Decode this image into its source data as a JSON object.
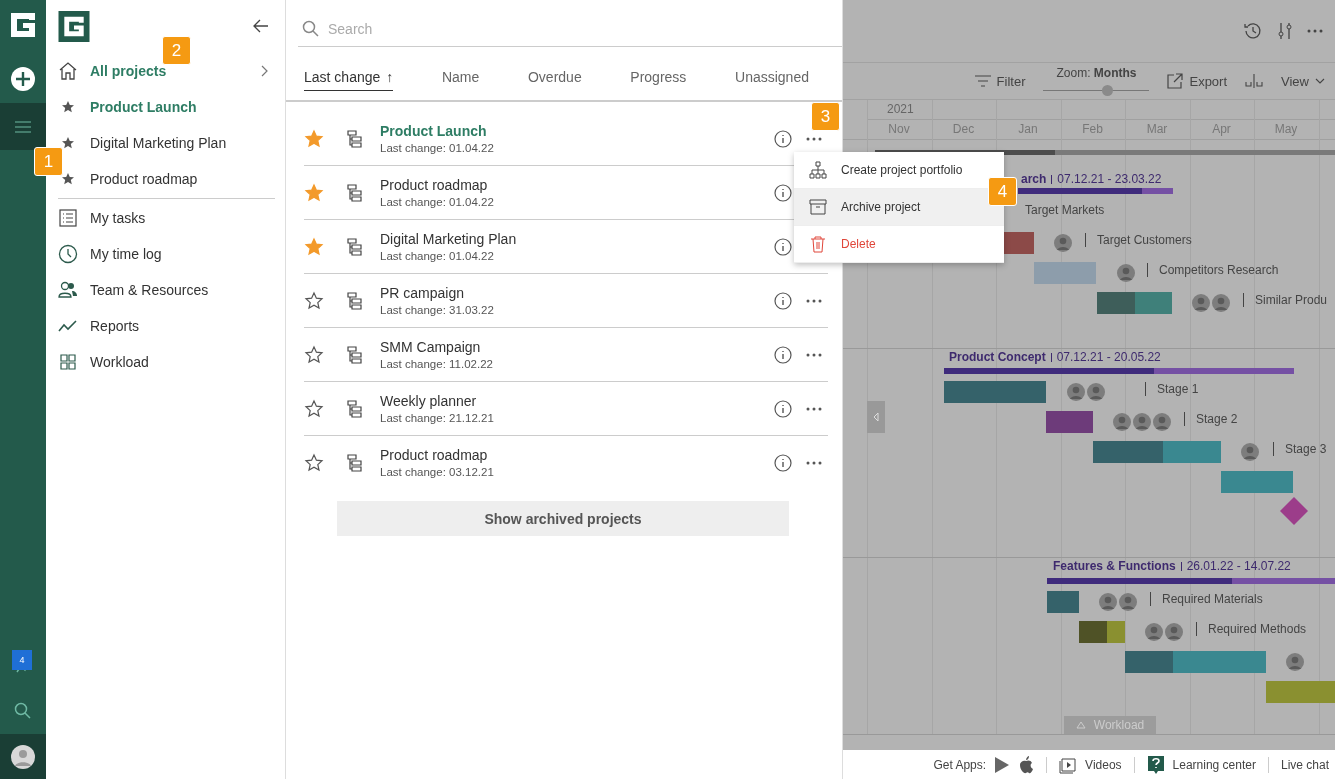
{
  "rail": {
    "notification_count": "4"
  },
  "sidebar": {
    "top": {
      "label": "All projects",
      "selected": true
    },
    "favorites": [
      {
        "label": "Product Launch",
        "selected": true
      },
      {
        "label": "Digital Marketing Plan",
        "selected": false
      },
      {
        "label": "Product roadmap",
        "selected": false
      }
    ],
    "menu": [
      {
        "label": "My tasks",
        "kind": "tasks"
      },
      {
        "label": "My time log",
        "kind": "timelog"
      },
      {
        "label": "Team & Resources",
        "kind": "team"
      },
      {
        "label": "Reports",
        "kind": "reports"
      },
      {
        "label": "Workload",
        "kind": "workload"
      }
    ]
  },
  "projects_panel": {
    "search": {
      "placeholder": "Search"
    },
    "sort_tabs": [
      {
        "label": "Last change",
        "selected": true,
        "arrow": "↑"
      },
      {
        "label": "Name",
        "selected": false
      },
      {
        "label": "Overdue",
        "selected": false
      },
      {
        "label": "Progress",
        "selected": false
      },
      {
        "label": "Unassigned",
        "selected": false
      }
    ],
    "projects": [
      {
        "name": "Product Launch",
        "last_change": "Last change: 01.04.22",
        "starred": true,
        "selected": true
      },
      {
        "name": "Product roadmap",
        "last_change": "Last change: 01.04.22",
        "starred": true,
        "selected": false
      },
      {
        "name": "Digital Marketing Plan",
        "last_change": "Last change: 01.04.22",
        "starred": true,
        "selected": false
      },
      {
        "name": "PR campaign",
        "last_change": "Last change: 31.03.22",
        "starred": false,
        "selected": false
      },
      {
        "name": "SMM Campaign",
        "last_change": "Last change: 11.02.22",
        "starred": false,
        "selected": false
      },
      {
        "name": "Weekly planner",
        "last_change": "Last change: 21.12.21",
        "starred": false,
        "selected": false
      },
      {
        "name": "Product roadmap",
        "last_change": "Last change: 03.12.21",
        "starred": false,
        "selected": false
      }
    ],
    "archived_button": "Show archived projects"
  },
  "context_menu": {
    "items": [
      {
        "label": "Create project portfolio",
        "kind": "portfolio",
        "selected": false
      },
      {
        "label": "Archive project",
        "kind": "archive",
        "selected": true
      },
      {
        "label": "Delete",
        "kind": "delete",
        "selected": false
      }
    ]
  },
  "gantt": {
    "toolbar": {
      "filter": "Filter",
      "zoom": {
        "label": "Zoom:",
        "value": "Months",
        "level": 0.6
      },
      "export": "Export",
      "view": "View"
    },
    "year": "2021",
    "months": [
      "Nov",
      "Dec",
      "Jan",
      "Feb",
      "Mar",
      "Apr",
      "May"
    ],
    "groups": [
      {
        "title": "arch",
        "dates": "07.12.21 - 23.03.22",
        "level": 0.8,
        "tasks": [
          {
            "label": "Target Markets"
          },
          {
            "label": "Target Customers"
          },
          {
            "label": "Competitors Research"
          },
          {
            "label": "Similar Produ"
          }
        ]
      },
      {
        "title": "Product Concept",
        "dates": "07.12.21 - 20.05.22",
        "level": 0.6,
        "tasks": [
          {
            "label": "Stage 1"
          },
          {
            "label": "Stage 2"
          },
          {
            "label": "Stage 3"
          }
        ]
      },
      {
        "title": "Features & Functions",
        "dates": "26.01.22 - 14.07.22",
        "level": 0.64,
        "tasks": [
          {
            "label": "Required Materials"
          },
          {
            "label": "Required Methods"
          }
        ]
      }
    ],
    "workload_tab": "Workload"
  },
  "footer": {
    "get_apps": "Get Apps:",
    "videos": "Videos",
    "learning_center": "Learning center",
    "live_chat": "Live chat"
  },
  "callouts": [
    {
      "label": "1"
    },
    {
      "label": "2"
    },
    {
      "label": "3"
    },
    {
      "label": "4"
    }
  ]
}
